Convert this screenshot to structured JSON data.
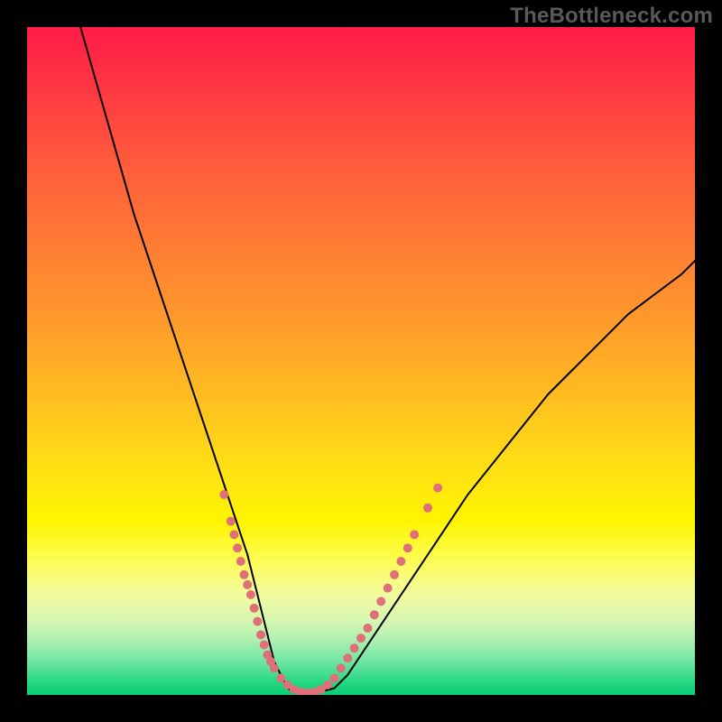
{
  "watermark": {
    "text": "TheBottleneck.com"
  },
  "chart_data": {
    "type": "line",
    "title": "",
    "xlabel": "",
    "ylabel": "",
    "xlim": [
      0,
      100
    ],
    "ylim": [
      0,
      100
    ],
    "series": [
      {
        "name": "curve",
        "x": [
          8,
          10,
          12,
          14,
          16,
          18,
          20,
          22,
          24,
          26,
          28,
          30,
          32,
          33,
          34,
          35,
          36,
          37,
          38,
          39,
          40,
          42,
          44,
          46,
          48,
          50,
          54,
          58,
          62,
          66,
          70,
          74,
          78,
          82,
          86,
          90,
          94,
          98,
          100
        ],
        "y": [
          100,
          93,
          86,
          79,
          72,
          66,
          60,
          54,
          48,
          42,
          36,
          30,
          24,
          21,
          17,
          13,
          9,
          5,
          3,
          1,
          0.5,
          0.3,
          0.5,
          1,
          3,
          6,
          12,
          18,
          24,
          30,
          35,
          40,
          45,
          49,
          53,
          57,
          60,
          63,
          65
        ],
        "stroke": "#000000",
        "stroke_width": 2
      }
    ],
    "highlight_dots": {
      "color": "#e07078",
      "radius": 5,
      "points": [
        {
          "x": 29.5,
          "y": 30
        },
        {
          "x": 30.5,
          "y": 26
        },
        {
          "x": 31.0,
          "y": 24
        },
        {
          "x": 31.5,
          "y": 22
        },
        {
          "x": 32.0,
          "y": 20
        },
        {
          "x": 32.5,
          "y": 18
        },
        {
          "x": 33.0,
          "y": 16.5
        },
        {
          "x": 33.5,
          "y": 15
        },
        {
          "x": 34.0,
          "y": 13
        },
        {
          "x": 34.5,
          "y": 11
        },
        {
          "x": 35.0,
          "y": 9
        },
        {
          "x": 35.5,
          "y": 7.5
        },
        {
          "x": 36.0,
          "y": 6
        },
        {
          "x": 36.5,
          "y": 5
        },
        {
          "x": 37.0,
          "y": 4
        },
        {
          "x": 38.0,
          "y": 2.5
        },
        {
          "x": 39.0,
          "y": 1.5
        },
        {
          "x": 40.0,
          "y": 0.8
        },
        {
          "x": 41.0,
          "y": 0.4
        },
        {
          "x": 42.0,
          "y": 0.3
        },
        {
          "x": 43.0,
          "y": 0.4
        },
        {
          "x": 44.0,
          "y": 0.8
        },
        {
          "x": 45.0,
          "y": 1.5
        },
        {
          "x": 46.0,
          "y": 2.5
        },
        {
          "x": 47.0,
          "y": 4
        },
        {
          "x": 48.0,
          "y": 5.5
        },
        {
          "x": 49.0,
          "y": 7
        },
        {
          "x": 50.0,
          "y": 8.5
        },
        {
          "x": 51.0,
          "y": 10
        },
        {
          "x": 52.0,
          "y": 12
        },
        {
          "x": 53.0,
          "y": 14
        },
        {
          "x": 54.0,
          "y": 16
        },
        {
          "x": 55.0,
          "y": 18
        },
        {
          "x": 56.0,
          "y": 20
        },
        {
          "x": 57.0,
          "y": 22
        },
        {
          "x": 58.0,
          "y": 24
        },
        {
          "x": 60.0,
          "y": 28
        },
        {
          "x": 61.5,
          "y": 31
        }
      ]
    }
  }
}
